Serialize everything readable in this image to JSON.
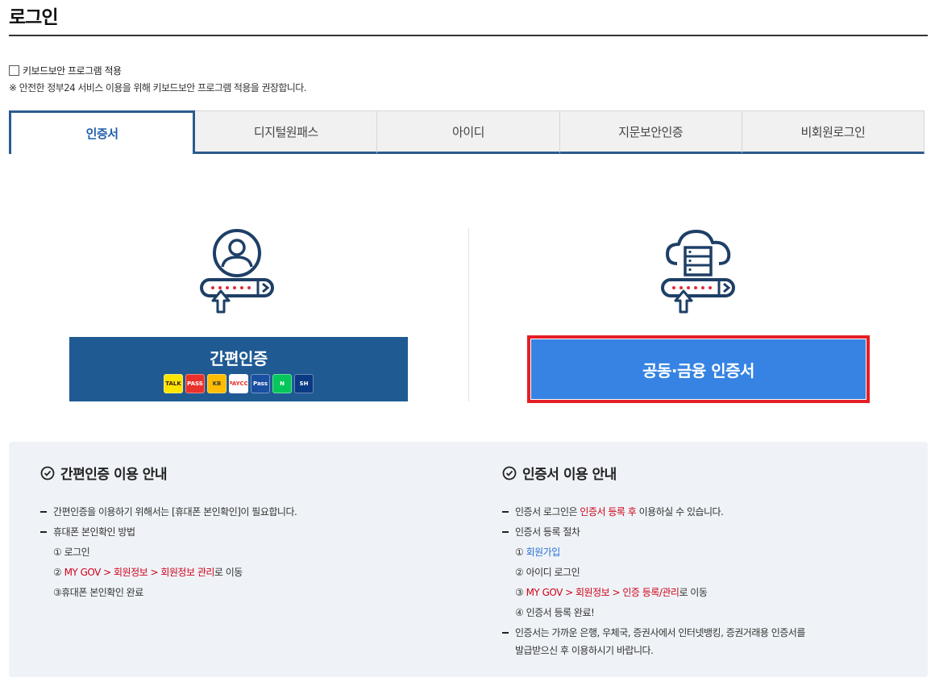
{
  "page": {
    "title": "로그인"
  },
  "keyboard_security": {
    "label": "키보드보안 프로그램 적용",
    "note": "※ 안전한 정부24 서비스 이용을 위해 키보드보안 프로그램 적용을 권장합니다."
  },
  "tabs": [
    {
      "label": "인증서",
      "active": true
    },
    {
      "label": "디지털원패스",
      "active": false
    },
    {
      "label": "아이디",
      "active": false
    },
    {
      "label": "지문보안인증",
      "active": false
    },
    {
      "label": "비회원로그인",
      "active": false
    }
  ],
  "simple_auth": {
    "label": "간편인증",
    "providers": [
      {
        "name": "kakao",
        "text": "TALK",
        "color": "#fee500",
        "fg": "#3c1e1e"
      },
      {
        "name": "pass",
        "text": "PASS",
        "color": "#e8322b",
        "fg": "#ffffff"
      },
      {
        "name": "kb",
        "text": "KB",
        "color": "#ffbc00",
        "fg": "#3b3b3b"
      },
      {
        "name": "payco",
        "text": "PAYCO",
        "color": "#ffffff",
        "fg": "#e8322b"
      },
      {
        "name": "samsung-pass",
        "text": "Pass",
        "color": "#1b4fa1",
        "fg": "#ffffff"
      },
      {
        "name": "naver",
        "text": "N",
        "color": "#03c75a",
        "fg": "#ffffff"
      },
      {
        "name": "shinhan",
        "text": "SH",
        "color": "#0b3a84",
        "fg": "#ffffff"
      }
    ]
  },
  "cert_auth": {
    "label": "공동·금융 인증서"
  },
  "guide_left": {
    "title": "간편인증 이용 안내",
    "item1": "간편인증을 이용하기 위해서는 [휴대폰 본인확인]이 필요합니다.",
    "item2": "휴대폰 본인확인 방법",
    "step1": "① 로그인",
    "step2_num": "② ",
    "step2_red": "MY GOV > 회원정보 > 회원정보 관리",
    "step2_tail": "로 이동",
    "step3": "③휴대폰 본인확인 완료"
  },
  "guide_right": {
    "title": "인증서 이용 안내",
    "item1_head": "인증서 로그인은 ",
    "item1_red": "인증서 등록 후",
    "item1_tail": " 이용하실 수 있습니다.",
    "item2": "인증서 등록 절차",
    "step1_num": "① ",
    "step1_link": "회원가입",
    "step2": "② 아이디 로그인",
    "step3_num": "③ ",
    "step3_red": "MY GOV > 회원정보 > 인증 등록/관리",
    "step3_tail": "로 이동",
    "step4": "④ 인증서 등록 완료!",
    "item3_line1": "인증서는 가까운 은행, 우체국, 증권사에서 인터넷뱅킹, 증권거래용 인증서를",
    "item3_line2": "발급받으신 후 이용하시기 바랍니다."
  },
  "colors": {
    "navy": "#1f5a93",
    "blue": "#3683e3",
    "red_border": "#e51e25",
    "highlight_red": "#d0021b"
  }
}
